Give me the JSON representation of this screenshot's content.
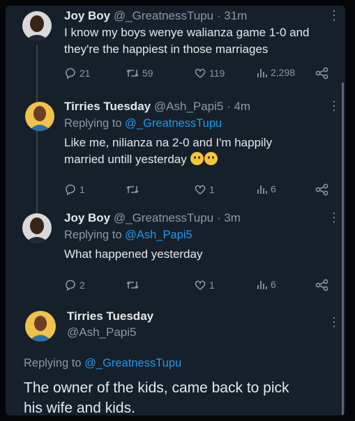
{
  "tweets": [
    {
      "name": "Joy Boy",
      "handle": "@_GreatnessTupu",
      "time": "· 31m",
      "replying_label": "",
      "replying_to": "",
      "text_lines": [
        "I know my boys wenye walianza game 1-0 and",
        "they're the happiest in those marriages"
      ],
      "replies": "21",
      "retweets": "59",
      "likes": "119",
      "views": "2,298"
    },
    {
      "name": "Tirries Tuesday",
      "handle": "@Ash_Papi5",
      "time": "· 4m",
      "replying_label": "Replying to",
      "replying_to": "@_GreatnessTupu",
      "text_lines": [
        "Like me, nilianza na 2-0 and I'm happily",
        "married untill yesterday"
      ],
      "replies": "1",
      "retweets": "",
      "likes": "1",
      "views": "6"
    },
    {
      "name": "Joy Boy",
      "handle": "@_GreatnessTupu",
      "time": "· 3m",
      "replying_label": "Replying to",
      "replying_to": "@Ash_Papi5",
      "text_lines": [
        "What happened yesterday"
      ],
      "replies": "2",
      "retweets": "",
      "likes": "1",
      "views": "6"
    }
  ],
  "main_tweet": {
    "name": "Tirries Tuesday",
    "handle": "@Ash_Papi5",
    "replying_label": "Replying to",
    "replying_to": "@_GreatnessTupu",
    "text_lines": [
      "The owner of the kids,  came back to pick",
      "his wife and kids."
    ]
  },
  "colors": {
    "background": "#15202b",
    "text": "#e7e9ea",
    "muted": "#8b98a5",
    "link": "#1d9bf0"
  }
}
